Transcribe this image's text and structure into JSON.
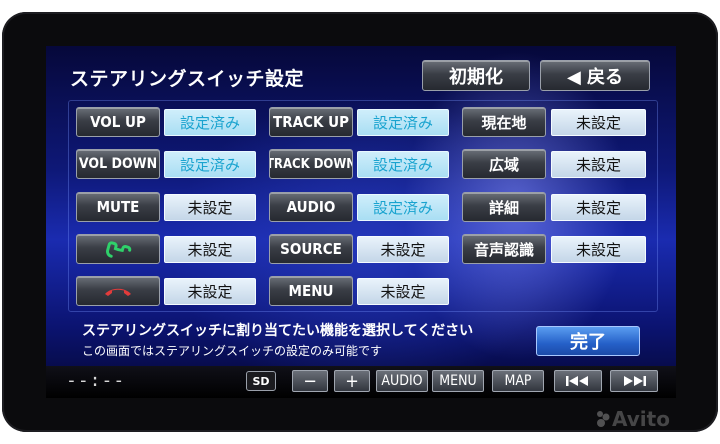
{
  "screen": {
    "title": "ステアリングスイッチ設定",
    "header_buttons": {
      "reset": "初期化",
      "back": "◀ 戻る"
    },
    "rows": [
      [
        {
          "label": "VOL UP",
          "status": "設定済み",
          "state": "done"
        },
        {
          "label": "TRACK UP",
          "status": "設定済み",
          "state": "done"
        },
        {
          "label": "現在地",
          "status": "未設定",
          "state": "unset"
        }
      ],
      [
        {
          "label": "VOL DOWN",
          "status": "設定済み",
          "state": "done"
        },
        {
          "label": "TRACK DOWN",
          "status": "設定済み",
          "state": "done"
        },
        {
          "label": "広域",
          "status": "未設定",
          "state": "unset"
        }
      ],
      [
        {
          "label": "MUTE",
          "status": "未設定",
          "state": "unset"
        },
        {
          "label": "AUDIO",
          "status": "設定済み",
          "state": "done"
        },
        {
          "label": "詳細",
          "status": "未設定",
          "state": "unset"
        }
      ],
      [
        {
          "icon": "phone-answer-icon",
          "status": "未設定",
          "state": "unset"
        },
        {
          "label": "SOURCE",
          "status": "未設定",
          "state": "unset"
        },
        {
          "label": "音声認識",
          "status": "未設定",
          "state": "unset"
        }
      ],
      [
        {
          "icon": "phone-hangup-icon",
          "status": "未設定",
          "state": "unset"
        },
        {
          "label": "MENU",
          "status": "未設定",
          "state": "unset"
        }
      ]
    ],
    "message_line1": "ステアリングスイッチに割り当てたい機能を選択してください",
    "message_line2": "この画面ではステアリングスイッチの設定のみ可能です",
    "done_button": "完了"
  },
  "bottom_bar": {
    "clock": "--:--",
    "sd_label": "SD",
    "buttons": {
      "minus": "−",
      "plus": "+",
      "audio": "AUDIO",
      "menu": "MENU",
      "map": "MAP"
    },
    "prev_icon": "skip-back-icon",
    "next_icon": "skip-forward-icon"
  },
  "colors": {
    "done_text": "#19a3cf",
    "answer_green": "#2fd06a",
    "hangup_red": "#e23b3b"
  },
  "watermark": "Avito"
}
